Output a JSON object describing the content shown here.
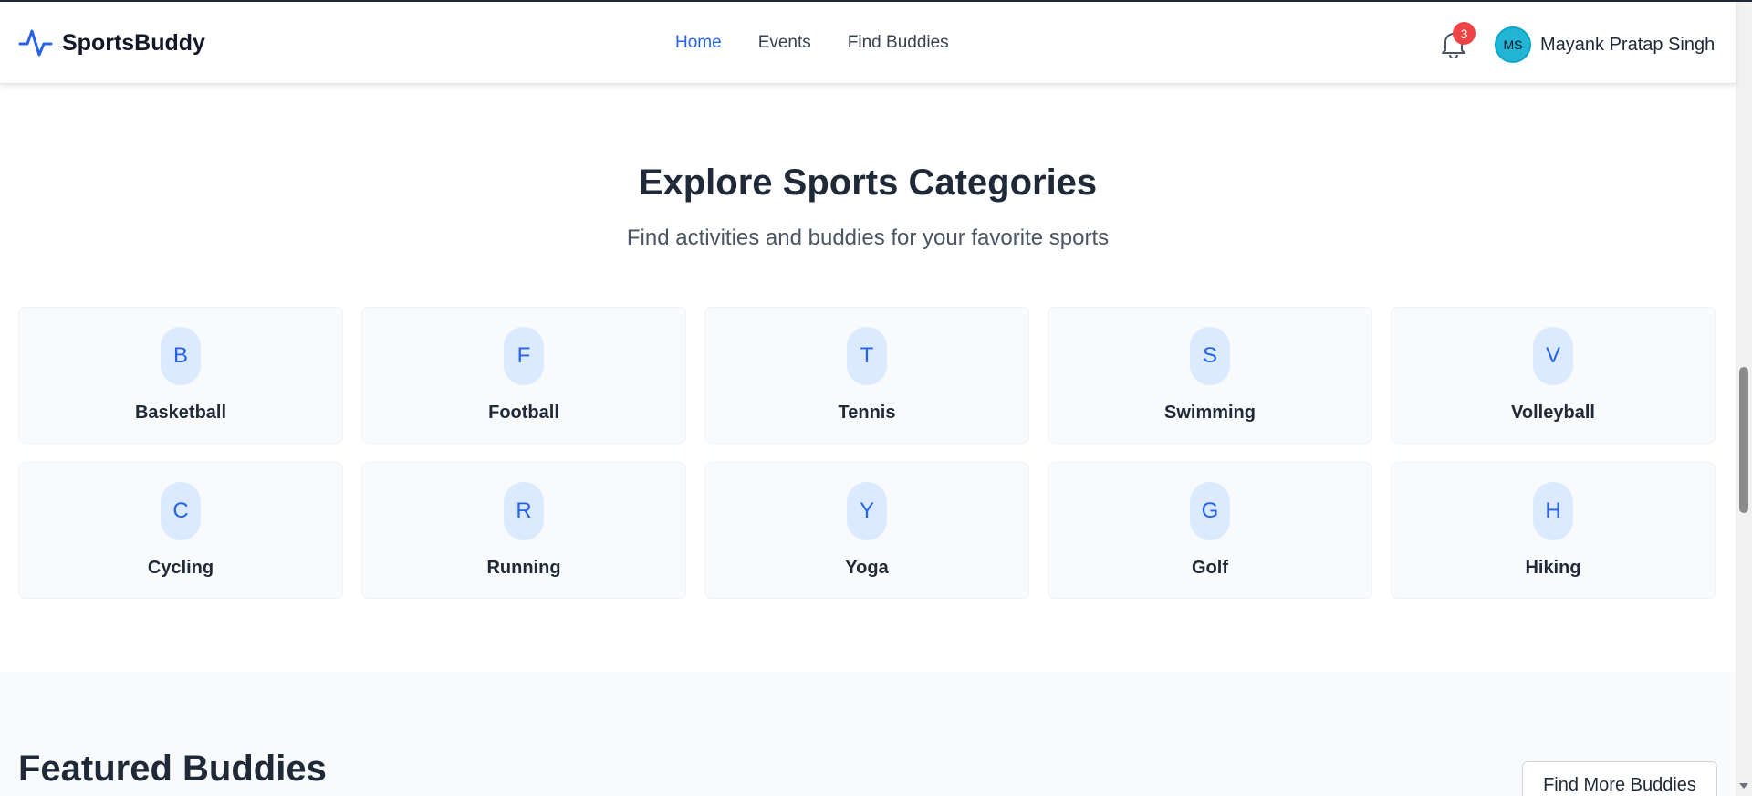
{
  "brand": {
    "name": "SportsBuddy",
    "accent": "#2563eb"
  },
  "nav": {
    "items": [
      {
        "label": "Home",
        "active": true
      },
      {
        "label": "Events",
        "active": false
      },
      {
        "label": "Find Buddies",
        "active": false
      }
    ]
  },
  "user": {
    "notification_count": "3",
    "initials": "MS",
    "name": "Mayank Pratap Singh"
  },
  "categories": {
    "title": "Explore Sports Categories",
    "subtitle": "Find activities and buddies for your favorite sports",
    "items": [
      {
        "letter": "B",
        "label": "Basketball"
      },
      {
        "letter": "F",
        "label": "Football"
      },
      {
        "letter": "T",
        "label": "Tennis"
      },
      {
        "letter": "S",
        "label": "Swimming"
      },
      {
        "letter": "V",
        "label": "Volleyball"
      },
      {
        "letter": "C",
        "label": "Cycling"
      },
      {
        "letter": "R",
        "label": "Running"
      },
      {
        "letter": "Y",
        "label": "Yoga"
      },
      {
        "letter": "G",
        "label": "Golf"
      },
      {
        "letter": "H",
        "label": "Hiking"
      }
    ]
  },
  "featured": {
    "title": "Featured Buddies",
    "button_label": "Find More Buddies"
  }
}
